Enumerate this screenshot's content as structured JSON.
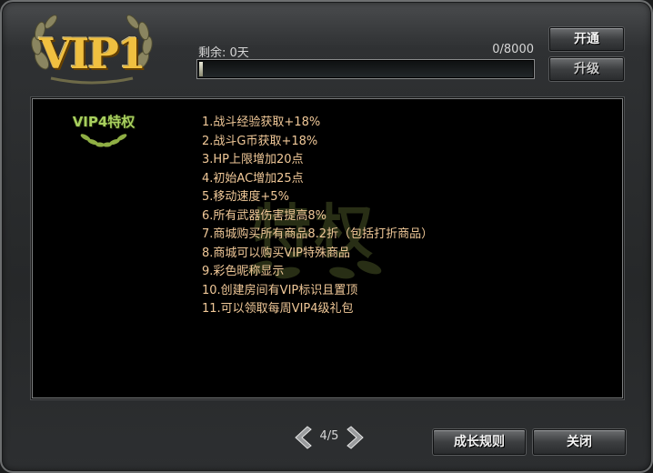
{
  "logo": {
    "text": "VIP1"
  },
  "status": {
    "remaining_label": "剩余: 0天",
    "progress_text": "0/8000",
    "progress_fraction": 0.0
  },
  "buttons": {
    "open": "开通",
    "upgrade": "升级",
    "growth_rules": "成长规则",
    "close": "关闭"
  },
  "privilege": {
    "badge_title": "VIP4特权",
    "watermark_text": "特权",
    "benefits": [
      "1.战斗经验获取+18%",
      "2.战斗G币获取+18%",
      "3.HP上限增加20点",
      "4.初始AC增加25点",
      "5.移动速度+5%",
      "6.所有武器伤害提高8%",
      "7.商城购买所有商品8.2折（包括打折商品）",
      "8.商城可以购买VIP特殊商品",
      "9.彩色昵称显示",
      "10.创建房间有VIP标识且置顶",
      "11.可以领取每周VIP4级礼包"
    ]
  },
  "pager": {
    "indicator": "4/5"
  },
  "colors": {
    "benefit_text": "#f0c898",
    "badge_green": "#a8cf5e",
    "logo_gold": "#f0c040"
  }
}
